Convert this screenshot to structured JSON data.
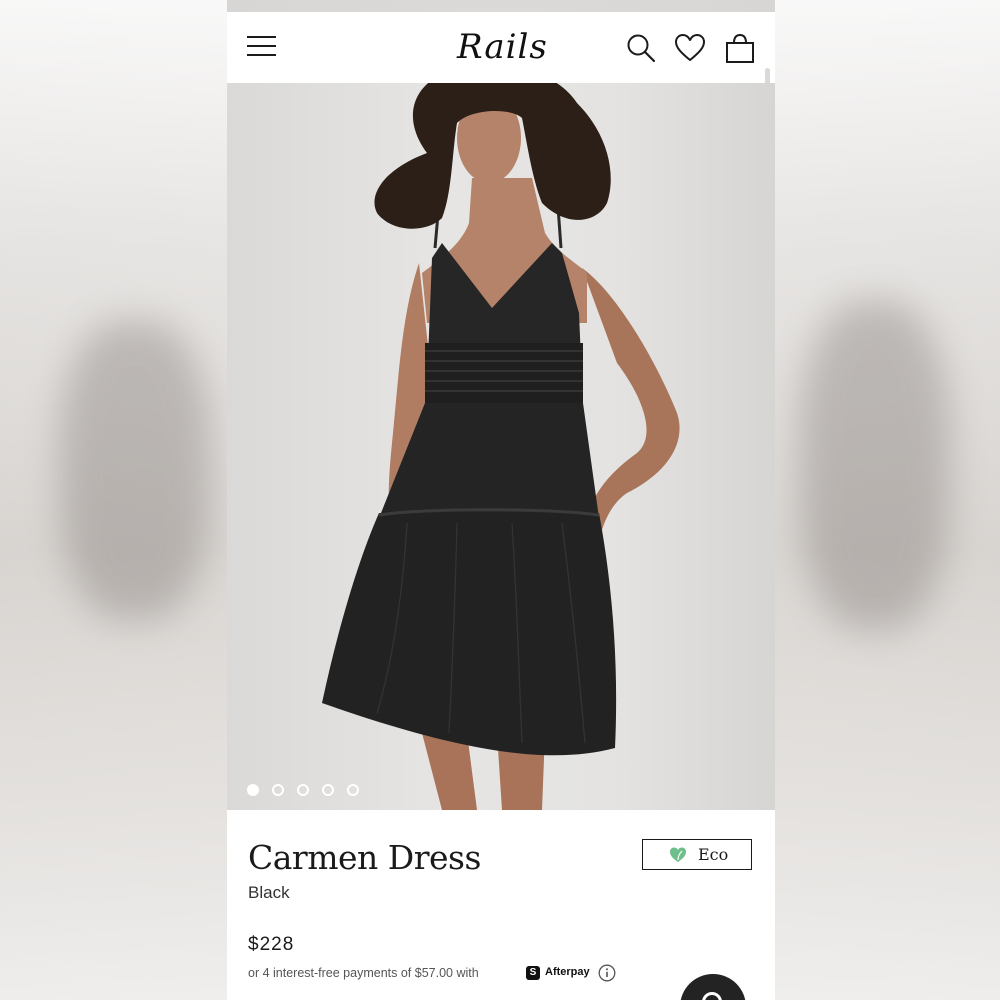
{
  "header": {
    "logo_text": "Rails",
    "icons": [
      "menu-icon",
      "search-icon",
      "heart-icon",
      "shopping-bag-icon"
    ]
  },
  "gallery": {
    "image_count": 5,
    "active_index": 0
  },
  "product": {
    "name": "Carmen Dress",
    "color": "Black",
    "badge": "Eco",
    "price": "$228",
    "installments": "or 4 interest-free payments of $57.00 with",
    "afterpay_label": "Afterpay"
  },
  "colors": {
    "eco_leaf": "#6fbf8a",
    "text": "#1a1a1a",
    "chat_button": "#232323"
  }
}
